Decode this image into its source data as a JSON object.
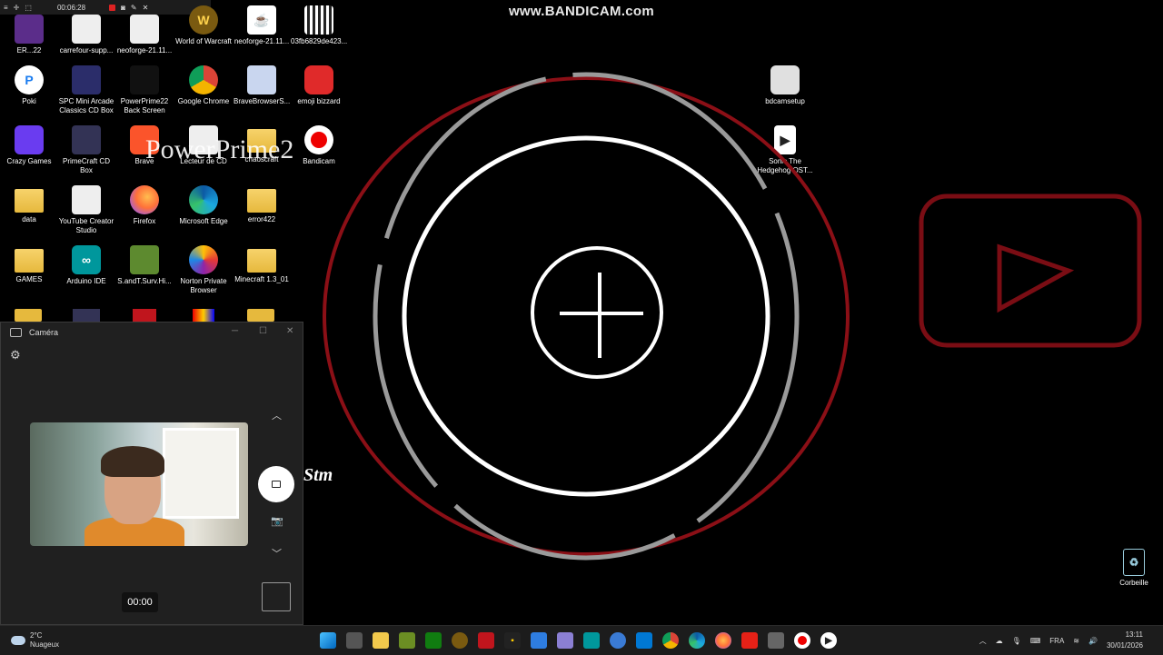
{
  "watermark": {
    "text": "www.BANDICAM.com"
  },
  "bandicam_bar": {
    "timer": "00:06:28"
  },
  "desktop": {
    "overlay_text": "PowerPrime2",
    "logo_text": "Stm",
    "icons": [
      {
        "label": "ER...22",
        "glyph": ""
      },
      {
        "label": "carrefour-supp...",
        "glyph": ""
      },
      {
        "label": "neoforge-21.11...",
        "glyph": ""
      },
      {
        "label": "World of Warcraft",
        "glyph": "W"
      },
      {
        "label": "neoforge-21.11...",
        "glyph": "☕"
      },
      {
        "label": "03fb6829de423...",
        "glyph": ""
      },
      {
        "label": "Poki",
        "glyph": "P"
      },
      {
        "label": "SPC Mini Arcade Classics CD Box",
        "glyph": ""
      },
      {
        "label": "PowerPrime22 Back Screen",
        "glyph": ""
      },
      {
        "label": "Google Chrome",
        "glyph": ""
      },
      {
        "label": "BraveBrowserS...",
        "glyph": ""
      },
      {
        "label": "emoji bizzard",
        "glyph": ""
      },
      {
        "label": "Crazy Games",
        "glyph": ""
      },
      {
        "label": "PrimeCraft CD Box",
        "glyph": ""
      },
      {
        "label": "Brave",
        "glyph": ""
      },
      {
        "label": "Lecteur de CD",
        "glyph": ""
      },
      {
        "label": "chaoscraft",
        "glyph": ""
      },
      {
        "label": "Bandicam",
        "glyph": ""
      },
      {
        "label": "data",
        "glyph": ""
      },
      {
        "label": "YouTube Creator Studio",
        "glyph": ""
      },
      {
        "label": "Firefox",
        "glyph": ""
      },
      {
        "label": "Microsoft Edge",
        "glyph": ""
      },
      {
        "label": "error422",
        "glyph": ""
      },
      {
        "label": "GAMES",
        "glyph": ""
      },
      {
        "label": "Arduino IDE",
        "glyph": "∞"
      },
      {
        "label": "S.andT.Surv.Hi...",
        "glyph": ""
      },
      {
        "label": "Norton Private Browser",
        "glyph": ""
      },
      {
        "label": "Minecraft 1.3_01",
        "glyph": ""
      },
      {
        "label": "bdcamsetup",
        "glyph": ""
      },
      {
        "label": "Sonic The Hedgehog OST...",
        "glyph": "▶"
      },
      {
        "label": "Corbeille",
        "glyph": "♻"
      }
    ]
  },
  "camera": {
    "title": "Caméra",
    "timer": "00:00"
  },
  "taskbar": {
    "weather_temp": "2°C",
    "weather_desc": "Nuageux",
    "lang": "FRA",
    "time": "13:11",
    "date": "30/01/2026"
  },
  "colors": {
    "circle_red": "#8b0f16",
    "circle_grey": "#9a9a9a",
    "circle_white": "#ffffff",
    "youtube_outline": "#7a0d14"
  }
}
